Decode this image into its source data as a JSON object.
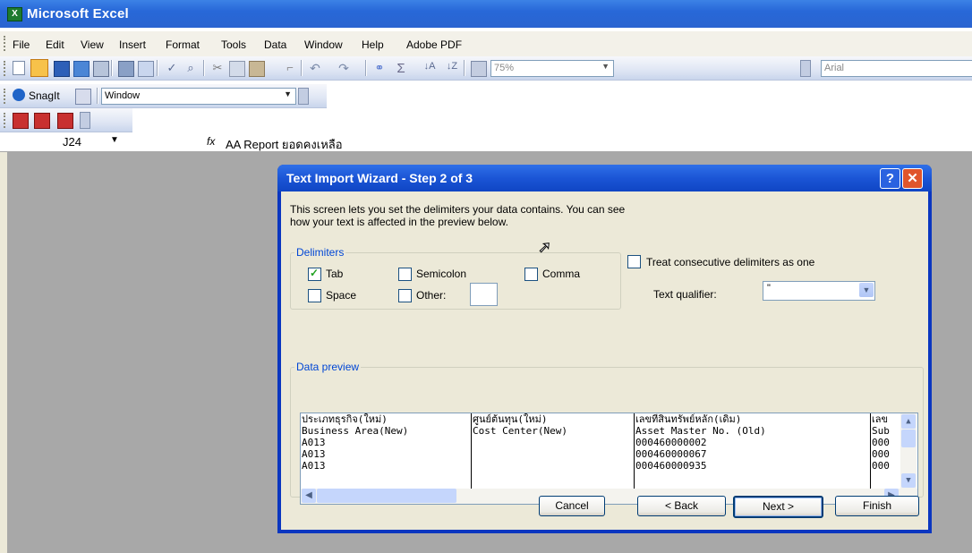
{
  "app": {
    "title": "Microsoft Excel"
  },
  "menu": [
    "File",
    "Edit",
    "View",
    "Insert",
    "Format",
    "Tools",
    "Data",
    "Window",
    "Help",
    "Adobe PDF"
  ],
  "toolbar": {
    "zoom": "75%",
    "font": "Arial"
  },
  "snagit": {
    "label": "SnagIt",
    "window_label": "Window"
  },
  "formula_bar": {
    "cell_ref": "J24",
    "fx": "fx",
    "content": "AA Report ยอดคงเหลือ"
  },
  "dialog": {
    "title": "Text Import Wizard - Step 2 of 3",
    "intro_line1": "This screen lets you set the delimiters your data contains.  You can see",
    "intro_line2": "how your text is affected in the preview below.",
    "delimiters_label": "Delimiters",
    "tab": {
      "label": "Tab",
      "checked": true
    },
    "semicolon": {
      "label": "Semicolon",
      "checked": false
    },
    "comma": {
      "label": "Comma",
      "checked": false
    },
    "space": {
      "label": "Space",
      "checked": false
    },
    "other": {
      "label": "Other:",
      "checked": false,
      "value": ""
    },
    "treat_consecutive": {
      "label": "Treat consecutive delimiters as one",
      "checked": false
    },
    "text_qualifier_label": "Text qualifier:",
    "text_qualifier_value": "\"",
    "data_preview_label": "Data preview",
    "preview_columns": [
      [
        "ประเภทธุรกิจ(ใหม่)",
        "Business Area(New)",
        "A013",
        "A013",
        "A013"
      ],
      [
        "ศูนย์ต้นทุน(ใหม่)",
        "Cost Center(New)",
        "",
        "",
        ""
      ],
      [
        "เลขที่สินทรัพย์หลัก(เดิม)",
        "Asset Master No.  (Old)",
        "000460000002",
        "000460000067",
        "000460000935"
      ],
      [
        "เลข",
        "Sub",
        "000",
        "000",
        "000"
      ]
    ],
    "buttons": {
      "cancel": "Cancel",
      "back": "< Back",
      "next": "Next >",
      "finish": "Finish"
    }
  }
}
